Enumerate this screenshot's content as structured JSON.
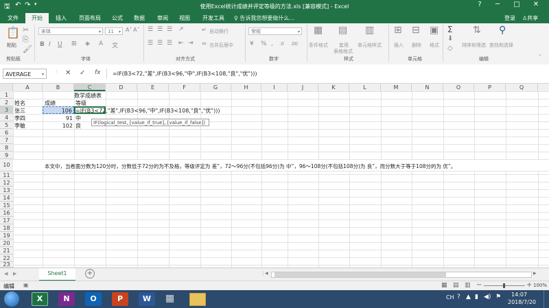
{
  "window": {
    "title": "使用Excel统计成绩并评定等级的方法.xls  [兼容模式] - Excel",
    "buttons": [
      "?",
      "─",
      "□",
      "✕"
    ]
  },
  "ribbon_tabs": [
    "文件",
    "开始",
    "插入",
    "页面布局",
    "公式",
    "数据",
    "审阅",
    "视图",
    "开发工具"
  ],
  "tellme": "♀ 告诉我您想要做什么...",
  "account": {
    "login": "登录",
    "share": "共享"
  },
  "ribbon": {
    "paste": "粘贴",
    "font_name": "宋体",
    "font_size": "11",
    "wrap_text": "自动换行",
    "merge_center": "合并后居中",
    "number_format": "常规",
    "conditional_format": "条件格式",
    "table_format_1": "套用",
    "table_format_2": "表格格式",
    "cell_styles": "单元格样式",
    "insert": "插入",
    "delete": "删除",
    "format": "格式",
    "sort_filter": "排序和筛选",
    "find_select": "查找和选择",
    "groups": [
      "剪贴板",
      "字体",
      "对齐方式",
      "数字",
      "样式",
      "单元格",
      "编辑"
    ]
  },
  "namebox": "AVERAGE",
  "formula_buttons": {
    "cancel": "✕",
    "enter": "✓",
    "fx": "fx"
  },
  "formula": "=IF(B3<72,\"差\",IF(B3<96,\"中\",IF(B3<108,\"良\",\"优\")))",
  "columns": [
    "A",
    "B",
    "C",
    "D",
    "E",
    "F",
    "G",
    "H",
    "I",
    "J",
    "K",
    "L",
    "M",
    "N",
    "O",
    "P",
    "Q"
  ],
  "rows": [
    "1",
    "2",
    "3",
    "4",
    "5",
    "6",
    "7",
    "8",
    "9",
    "10",
    "11",
    "12",
    "13",
    "14",
    "15",
    "16",
    "17",
    "18",
    "19",
    "20",
    "21",
    "22",
    "23"
  ],
  "cells": {
    "c1": "数学成绩表",
    "a2": "姓名",
    "b2": "成绩",
    "c2": "等级",
    "a3": "张三",
    "b3": "106",
    "c3": "=IF(B3<72,\"差\",IF(B3<96,\"中\",IF(B3<108,\"良\",\"优\")))",
    "a4": "李四",
    "b4": "91",
    "c4": "中",
    "a5": "李敏",
    "b5": "102",
    "c5": "良",
    "b10": "本文中，当卷面分数为120分时，分数低于72分的为不及格，等级评定为 差”，72～96分(不包括96分)为 中”，96～108分(不包括108分)为 良”，而分数大于等于108分的为 优”。"
  },
  "tooltip": "IF(logical_test, [value_if_true], [value_if_false])",
  "sheet_tabs": [
    "Sheet1"
  ],
  "status": {
    "mode": "编辑",
    "zoom": "100%"
  },
  "taskbar": {
    "apps": [
      "X",
      "N",
      "O",
      "P",
      "W"
    ],
    "lang": "CH",
    "time": "14:07",
    "date": "2018/7/20"
  },
  "colors": {
    "excel_green": "#217346",
    "taskbar": "#2c4a6b"
  }
}
